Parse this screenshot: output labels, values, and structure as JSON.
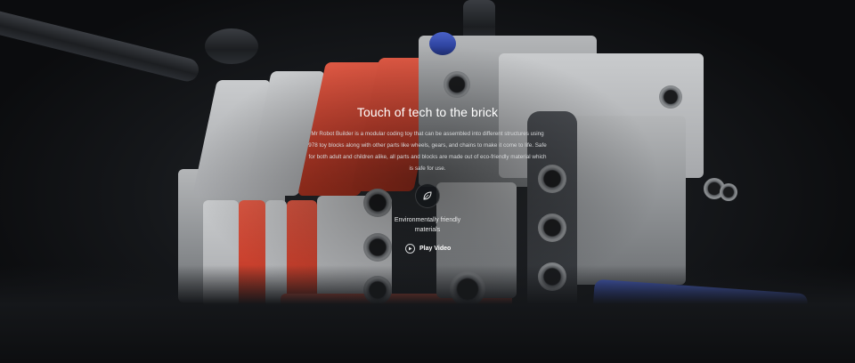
{
  "hero": {
    "title": "Touch of tech to the brick",
    "description": "Mr Robot Builder is a modular coding toy that can be assembled into different structures using 978 toy blocks along with other parts like wheels, gears, and chains to make it come to life. Safe for both adult and children alike, all parts and blocks are made out of eco-friendly material which is safe for use.",
    "feature": {
      "icon": "leaf-icon",
      "label": "Environmentally friendly materials"
    },
    "play": {
      "icon": "play-icon",
      "label": "Play Video"
    }
  },
  "colors": {
    "brick_red": "#c8402d",
    "brick_gray": "#8d9093",
    "pin_blue": "#2f44a0",
    "text": "#ffffff"
  }
}
